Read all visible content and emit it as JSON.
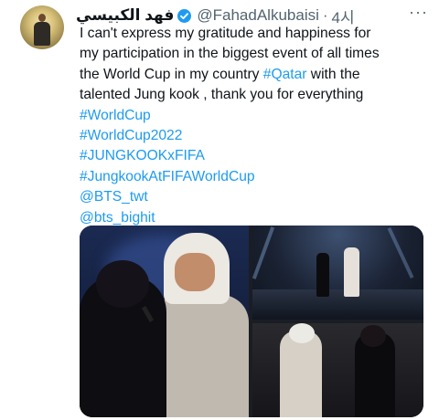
{
  "tweet": {
    "display_name": "فهد الكبيسي",
    "handle": "@FahadAlkubaisi",
    "separator": "·",
    "time": "4시",
    "more_label": "···",
    "lines": [
      {
        "text": "I can't express my gratitude and happiness for",
        "type": "text"
      },
      {
        "text": "my participation in the biggest event of all times",
        "type": "text"
      },
      {
        "text": "the World Cup in my country ",
        "tag": "#Qatar",
        "rest": " with the",
        "type": "mixed"
      },
      {
        "text": "talented Jung kook , thank you for everything",
        "type": "text"
      },
      {
        "text": "#WorldCup",
        "type": "tag"
      },
      {
        "text": "#WorldCup2022",
        "type": "tag"
      },
      {
        "text": "#JUNGKOOKxFIFA",
        "type": "tag"
      },
      {
        "text": "#JungkookAtFIFAWorldCup",
        "type": "tag"
      },
      {
        "text": "@BTS_twt",
        "type": "tag"
      },
      {
        "text": "@bts_bighit",
        "type": "tag"
      }
    ],
    "media_count": 3
  },
  "colors": {
    "link": "#1d9bf0",
    "text": "#0f1419",
    "secondary": "#536471",
    "verified": "#1d9bf0"
  },
  "icons": {
    "verified": "verified-badge-icon",
    "more": "more-options-icon"
  }
}
